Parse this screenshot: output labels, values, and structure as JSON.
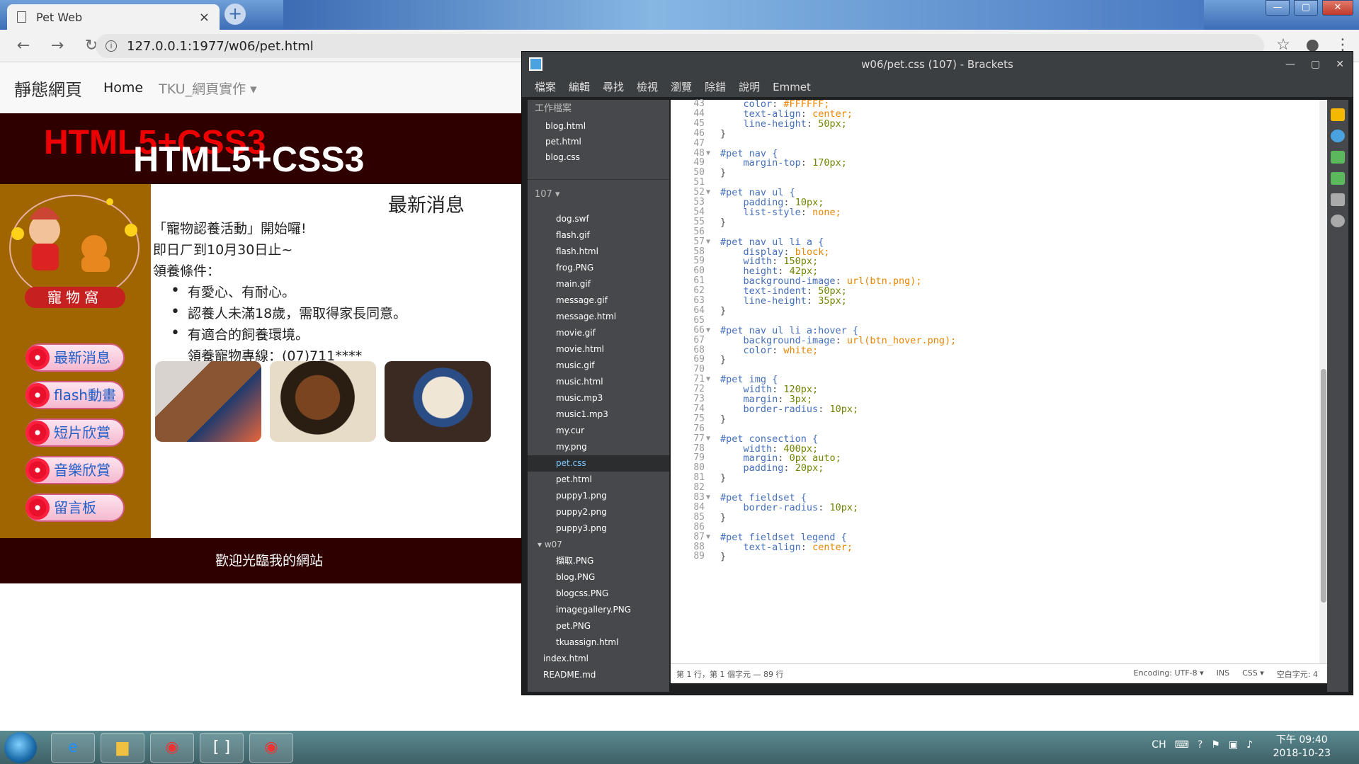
{
  "browser": {
    "tab_title": "Pet Web",
    "tab_close": "×",
    "new_tab": "+",
    "url": "127.0.0.1:1977/w06/pet.html",
    "back": "←",
    "forward": "→",
    "reload": "↻",
    "star": "☆",
    "account": "●",
    "menu": "⋮",
    "win_min": "—",
    "win_max": "▢",
    "win_close": "✕"
  },
  "page": {
    "brand": "靜態網頁",
    "nav_home": "Home",
    "nav_dropdown": "TKU_網頁實作 ▾",
    "header_red": "HTML5+CSS3",
    "header_white": "HTML5+CSS3",
    "logo_text": "寵物窩",
    "buttons": [
      "最新消息",
      "flash動畫",
      "短片欣賞",
      "音樂欣賞",
      "留言板"
    ],
    "main_title": "最新消息",
    "p1": "「寵物認養活動」開始囉!",
    "p2": "即日ㄏ到10月30日止~",
    "p3": "領養條件：",
    "list": [
      "有愛心、有耐心。",
      "認養人未滿18歲，需取得家長同意。",
      "有適合的飼養環境。"
    ],
    "hotline": "領養寵物專線：(07)711****",
    "footer": "歡迎光臨我的網站"
  },
  "brackets": {
    "title": "w06/pet.css (107) - Brackets",
    "menu": [
      "檔案",
      "編輯",
      "尋找",
      "檢視",
      "瀏覽",
      "除錯",
      "說明",
      "Emmet"
    ],
    "working_files_label": "工作檔案",
    "working_files": [
      "blog.html",
      "pet.html",
      "blog.css"
    ],
    "project_label": "107 ▾",
    "tree_w06": [
      "dog.swf",
      "flash.gif",
      "flash.html",
      "frog.PNG",
      "main.gif",
      "message.gif",
      "message.html",
      "movie.gif",
      "movie.html",
      "music.gif",
      "music.html",
      "music.mp3",
      "music1.mp3",
      "my.cur",
      "my.png",
      "pet.css",
      "pet.html",
      "puppy1.png",
      "puppy2.png",
      "puppy3.png"
    ],
    "selected_file": "pet.css",
    "dir_w07": "▾ w07",
    "tree_w07": [
      "擷取.PNG",
      "blog.PNG",
      "blogcss.PNG",
      "imagegallery.PNG",
      "pet.PNG",
      "tkuassign.html"
    ],
    "root_files": [
      "index.html",
      "README.md"
    ],
    "status_left": "第 1 行，第 1 個字元 — 89 行",
    "status_encoding": "Encoding: UTF-8 ▾",
    "status_ins": "INS",
    "status_lang": "CSS ▾",
    "status_space": "空白字元: 4",
    "code_lines": [
      {
        "n": "43",
        "t": "    color: #FFFFFF;"
      },
      {
        "n": "44",
        "t": "    text-align: center;"
      },
      {
        "n": "45",
        "t": "    line-height: 50px;"
      },
      {
        "n": "46",
        "t": "}"
      },
      {
        "n": "47",
        "t": ""
      },
      {
        "n": "48",
        "t": "#pet nav {"
      },
      {
        "n": "49",
        "t": "    margin-top: 170px;"
      },
      {
        "n": "50",
        "t": "}"
      },
      {
        "n": "51",
        "t": ""
      },
      {
        "n": "52",
        "t": "#pet nav ul {"
      },
      {
        "n": "53",
        "t": "    padding: 10px;"
      },
      {
        "n": "54",
        "t": "    list-style: none;"
      },
      {
        "n": "55",
        "t": "}"
      },
      {
        "n": "56",
        "t": ""
      },
      {
        "n": "57",
        "t": "#pet nav ul li a {"
      },
      {
        "n": "58",
        "t": "    display: block;"
      },
      {
        "n": "59",
        "t": "    width: 150px;"
      },
      {
        "n": "60",
        "t": "    height: 42px;"
      },
      {
        "n": "61",
        "t": "    background-image: url(btn.png);"
      },
      {
        "n": "62",
        "t": "    text-indent: 50px;"
      },
      {
        "n": "63",
        "t": "    line-height: 35px;"
      },
      {
        "n": "64",
        "t": "}"
      },
      {
        "n": "65",
        "t": ""
      },
      {
        "n": "66",
        "t": "#pet nav ul li a:hover {"
      },
      {
        "n": "67",
        "t": "    background-image: url(btn_hover.png);"
      },
      {
        "n": "68",
        "t": "    color: white;"
      },
      {
        "n": "69",
        "t": "}"
      },
      {
        "n": "70",
        "t": ""
      },
      {
        "n": "71",
        "t": "#pet img {"
      },
      {
        "n": "72",
        "t": "    width: 120px;"
      },
      {
        "n": "73",
        "t": "    margin: 3px;"
      },
      {
        "n": "74",
        "t": "    border-radius: 10px;"
      },
      {
        "n": "75",
        "t": "}"
      },
      {
        "n": "76",
        "t": ""
      },
      {
        "n": "77",
        "t": "#pet consection {"
      },
      {
        "n": "78",
        "t": "    width: 400px;"
      },
      {
        "n": "79",
        "t": "    margin: 0px auto;"
      },
      {
        "n": "80",
        "t": "    padding: 20px;"
      },
      {
        "n": "81",
        "t": "}"
      },
      {
        "n": "82",
        "t": ""
      },
      {
        "n": "83",
        "t": "#pet fieldset {"
      },
      {
        "n": "84",
        "t": "    border-radius: 10px;"
      },
      {
        "n": "85",
        "t": "}"
      },
      {
        "n": "86",
        "t": ""
      },
      {
        "n": "87",
        "t": "#pet fieldset legend {"
      },
      {
        "n": "88",
        "t": "    text-align: center;"
      },
      {
        "n": "89",
        "t": "}"
      }
    ]
  },
  "taskbar": {
    "tray_lang": "CH",
    "clock_time": "下午 09:40",
    "clock_date": "2018-10-23"
  },
  "colors": {
    "header_bg": "#2e0000",
    "sidebar_bg": "#a06500",
    "brackets_sidebar": "#47484b",
    "selector": "#446fbd",
    "value_num": "#6d8600",
    "value_kw": "#e88501"
  }
}
